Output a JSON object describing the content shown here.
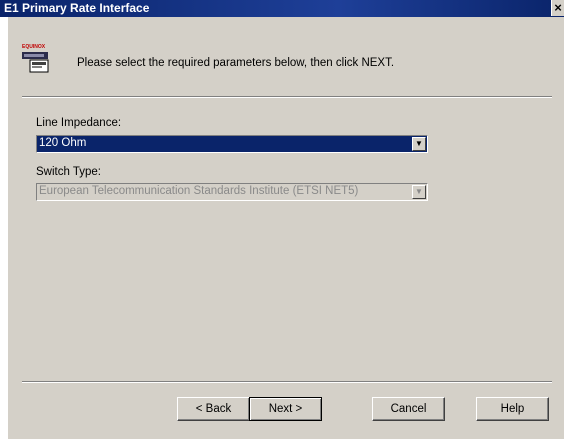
{
  "window": {
    "title": "E1 Primary Rate Interface",
    "close_label": "×"
  },
  "header": {
    "logo_text": "EQUINOX",
    "instruction": "Please select the required parameters below, then click NEXT."
  },
  "line_impedance": {
    "label": "Line Impedance:",
    "value": "120 Ohm"
  },
  "switch_type": {
    "label": "Switch Type:",
    "value": "European Telecommunication Standards Institute (ETSI NET5)"
  },
  "buttons": {
    "back": "< Back",
    "next": "Next >",
    "cancel": "Cancel",
    "help": "Help"
  },
  "colors": {
    "titlebar": "#0a246a",
    "dialog_bg": "#d4d0c8",
    "selection": "#0a246a"
  },
  "icons": {
    "header": "network-card-icon",
    "dropdown": "chevron-down-icon"
  }
}
